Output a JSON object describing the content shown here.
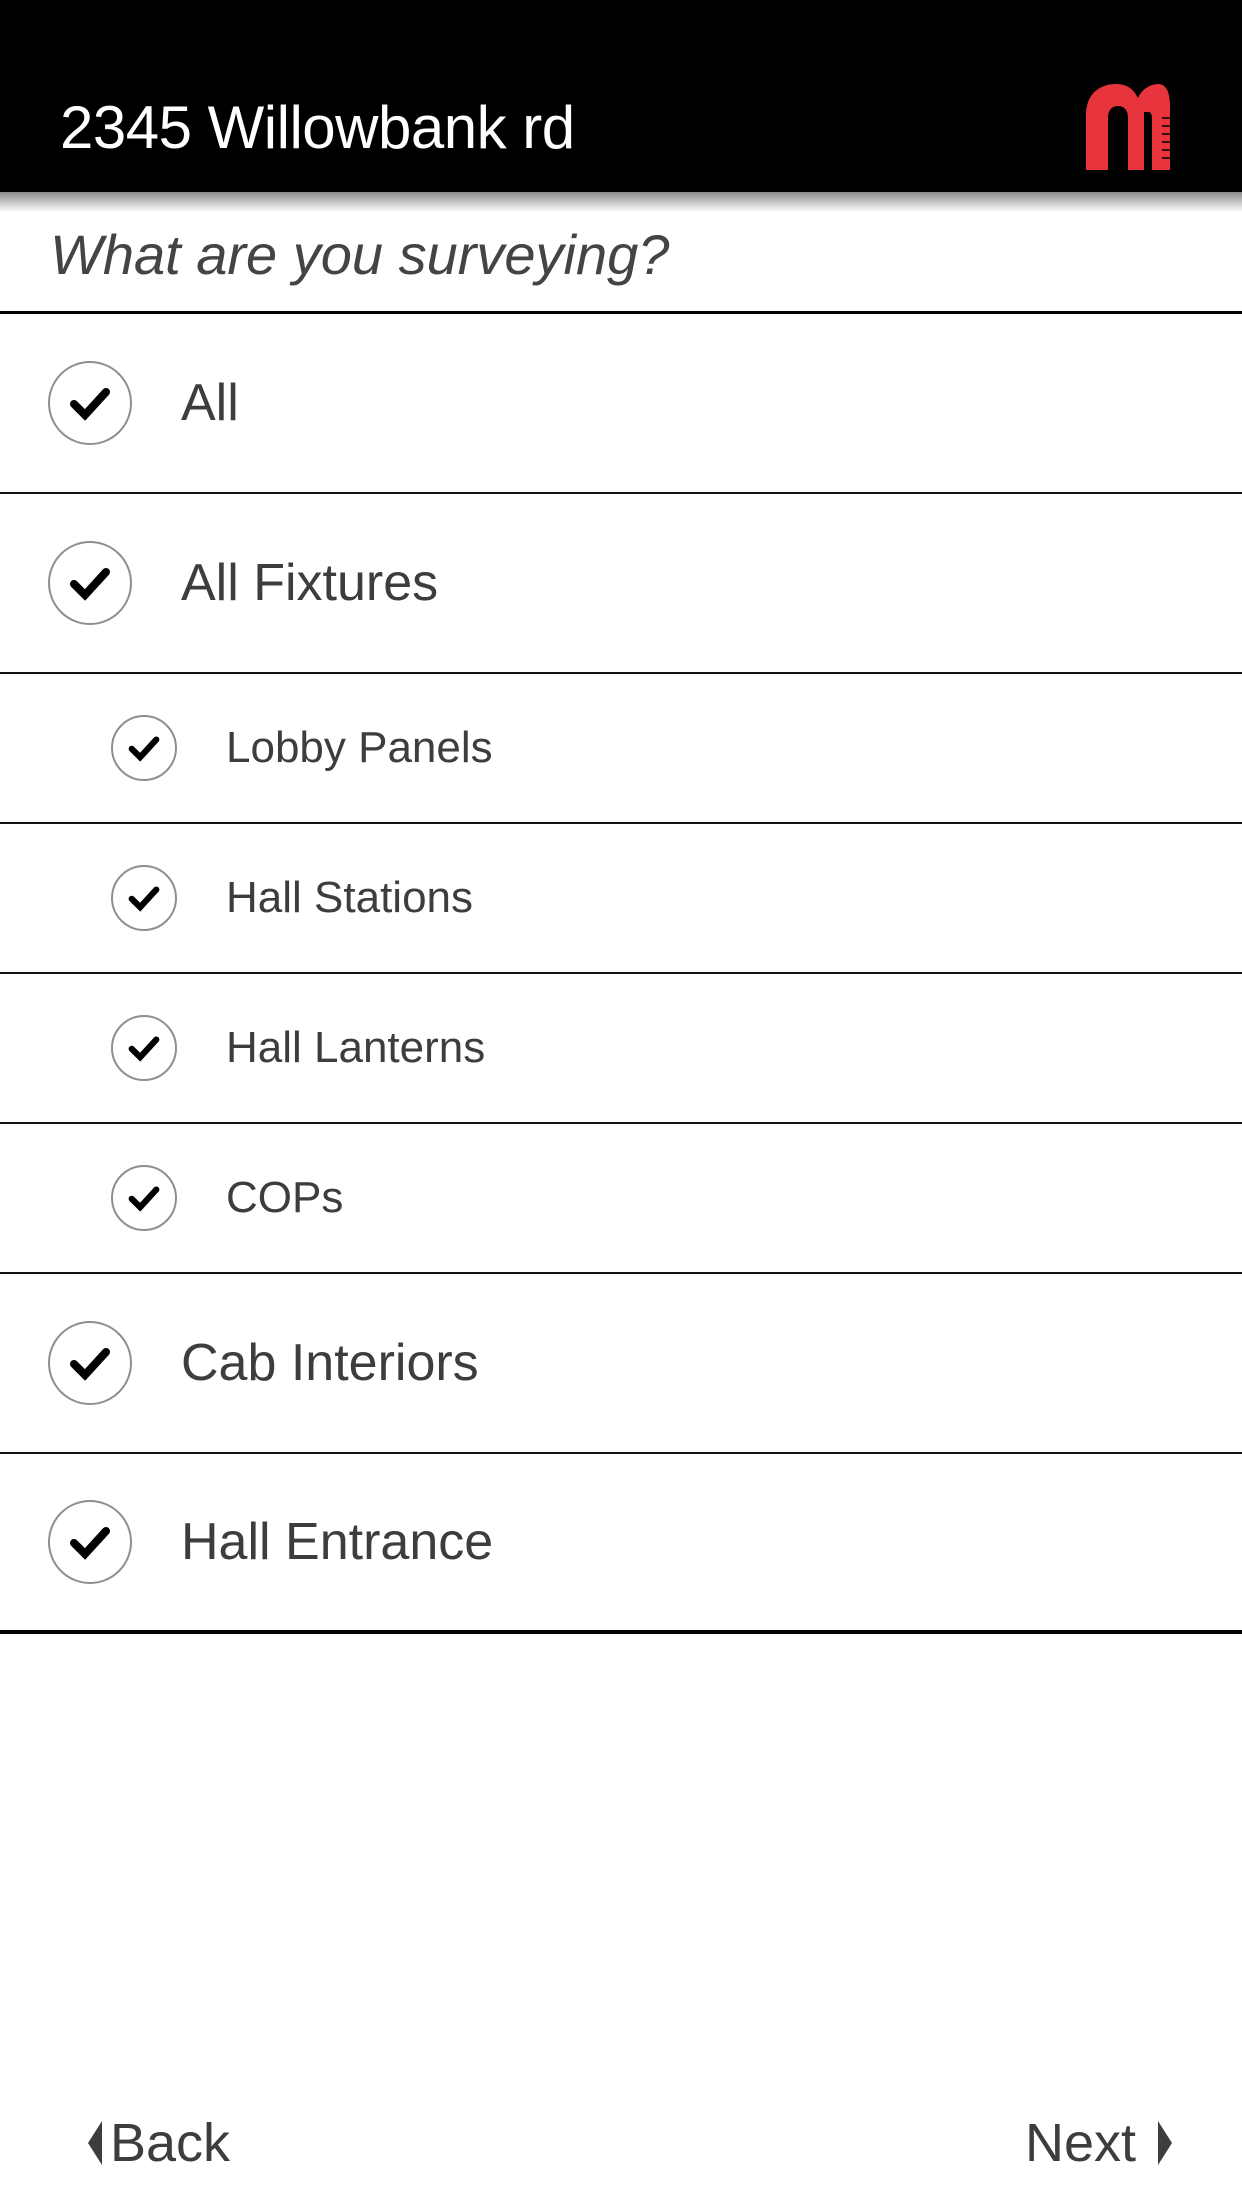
{
  "header": {
    "title": "2345 Willowbank rd",
    "logo_icon": "brand-logo-m-icon",
    "logo_color": "#e8343c",
    "background": "#000000"
  },
  "prompt": {
    "question": "What are you surveying?"
  },
  "options": [
    {
      "label": "All",
      "checked": true,
      "level": 0
    },
    {
      "label": "All Fixtures",
      "checked": true,
      "level": 0
    },
    {
      "label": "Lobby Panels",
      "checked": true,
      "level": 1
    },
    {
      "label": "Hall Stations",
      "checked": true,
      "level": 1
    },
    {
      "label": "Hall Lanterns",
      "checked": true,
      "level": 1
    },
    {
      "label": "COPs",
      "checked": true,
      "level": 1
    },
    {
      "label": "Cab Interiors",
      "checked": true,
      "level": 0
    },
    {
      "label": "Hall Entrance",
      "checked": true,
      "level": 0
    }
  ],
  "footer": {
    "back_label": "Back",
    "back_icon": "triangle-left-icon",
    "next_label": "Next",
    "next_icon": "triangle-right-icon"
  }
}
